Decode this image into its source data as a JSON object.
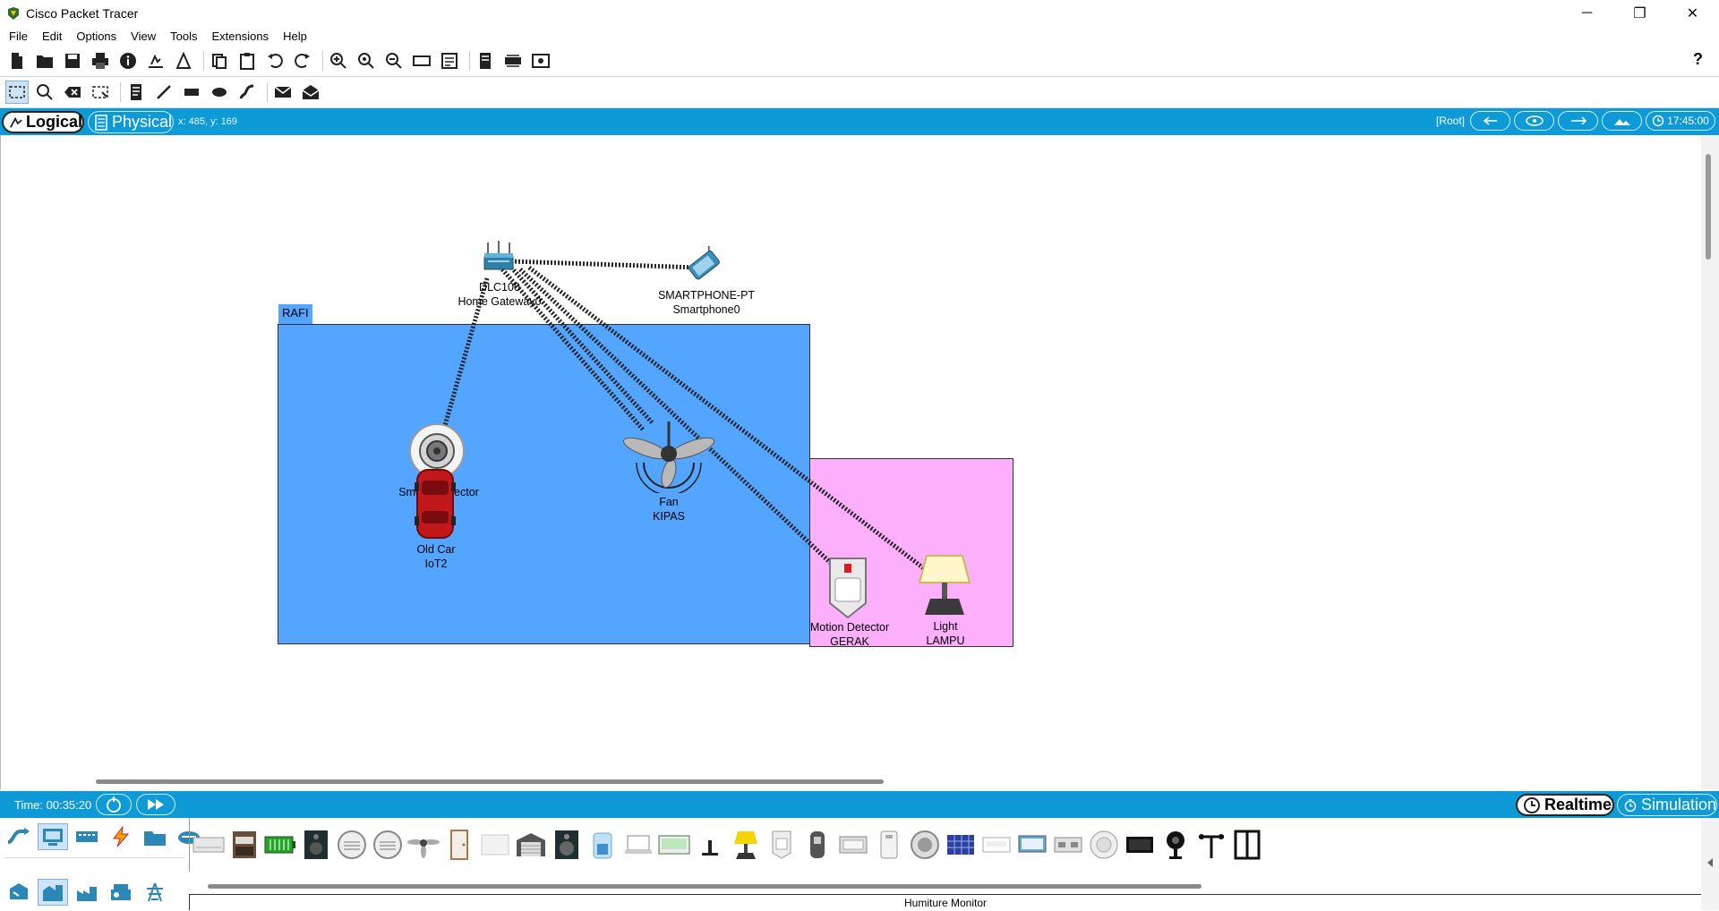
{
  "window": {
    "title": "Cisco Packet Tracer",
    "minimize": "─",
    "restore": "❐",
    "close": "✕"
  },
  "menu": [
    "File",
    "Edit",
    "Options",
    "View",
    "Tools",
    "Extensions",
    "Help"
  ],
  "toolbar_help": "?",
  "workspace": {
    "logical_label": "Logical",
    "physical_label": "Physical",
    "coords": "x: 485, y: 169",
    "root_label": "[Root]",
    "clock": "17:45:00"
  },
  "canvas": {
    "room_label": "RAFI",
    "devices": [
      {
        "id": "gateway",
        "line1": "DLC100",
        "line2": "Home Gateway0"
      },
      {
        "id": "smartphone",
        "line1": "SMARTPHONE-PT",
        "line2": "Smartphone0"
      },
      {
        "id": "smoke",
        "line1": "Smoke Detector",
        "line2": ""
      },
      {
        "id": "car",
        "line1": "Old Car",
        "line2": "IoT2"
      },
      {
        "id": "fan",
        "line1": "Fan",
        "line2": "KIPAS"
      },
      {
        "id": "motion",
        "line1": "Motion Detector",
        "line2": "GERAK"
      },
      {
        "id": "light",
        "line1": "Light",
        "line2": "LAMPU"
      }
    ]
  },
  "bottom": {
    "time": "Time: 00:35:20",
    "realtime_label": "Realtime",
    "simulation_label": "Simulation",
    "status_device": "Humiture Monitor"
  },
  "colors": {
    "accent": "#0e9ad6",
    "room_rafi": "#53a5ff",
    "room_pink": "#fcb0fb"
  }
}
